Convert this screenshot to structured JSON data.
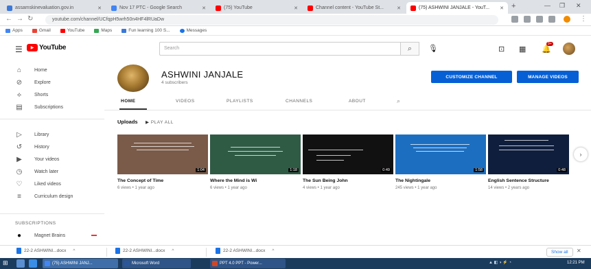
{
  "browser": {
    "tabs": [
      {
        "title": "assamskinevaluation.gov.in",
        "active": false,
        "color": "#3c78d8"
      },
      {
        "title": "Nov 17 PTC - Google Search",
        "active": false,
        "color": "#4285f4"
      },
      {
        "title": "(75) YouTube",
        "active": false,
        "color": "#ff0000"
      },
      {
        "title": "Channel content - YouTube St...",
        "active": false,
        "color": "#ff0000"
      },
      {
        "title": "(75) ASHWINI JANJALE - YouT...",
        "active": true,
        "color": "#ff0000"
      }
    ],
    "new_tab": "+",
    "url": "youtube.com/channel/UCfqpH5wrh50n4HF4lRUaDw",
    "bookmarks": [
      {
        "label": "Apps",
        "color": "#4285f4"
      },
      {
        "label": "Gmail",
        "color": "#ea4335"
      },
      {
        "label": "YouTube",
        "color": "#ff0000"
      },
      {
        "label": "Maps",
        "color": "#34a853"
      },
      {
        "label": "Fun learning 100 S...",
        "color": "#3c78d8"
      },
      {
        "label": "Messages",
        "color": "#1a73e8"
      }
    ]
  },
  "youtube": {
    "logo_text": "YouTube",
    "search_placeholder": "Search",
    "notification_count": "9+",
    "sidebar": {
      "primary": [
        {
          "label": "Home",
          "icon": "⌂"
        },
        {
          "label": "Explore",
          "icon": "⊘"
        },
        {
          "label": "Shorts",
          "icon": "⟡"
        },
        {
          "label": "Subscriptions",
          "icon": "▤"
        }
      ],
      "library": [
        {
          "label": "Library",
          "icon": "▷"
        },
        {
          "label": "History",
          "icon": "↺"
        },
        {
          "label": "Your videos",
          "icon": "▶"
        },
        {
          "label": "Watch later",
          "icon": "◷"
        },
        {
          "label": "Liked videos",
          "icon": "♡"
        },
        {
          "label": "Curriculum design",
          "icon": "≡"
        }
      ],
      "subscriptions_heading": "SUBSCRIPTIONS",
      "subscriptions": [
        {
          "label": "Magnet Brains"
        }
      ]
    },
    "channel": {
      "name": "ASHWINI JANJALE",
      "subscribers": "4 subscribers",
      "customize_button": "CUSTOMIZE CHANNEL",
      "manage_button": "MANAGE VIDEOS",
      "tabs": [
        "HOME",
        "VIDEOS",
        "PLAYLISTS",
        "CHANNELS",
        "ABOUT"
      ],
      "active_tab": "HOME",
      "uploads_label": "Uploads",
      "play_all_label": "PLAY ALL"
    },
    "videos": [
      {
        "title": "The Concept of Time",
        "meta": "6 views • 1 year ago",
        "duration": "1:04",
        "bg": "#7a5a48"
      },
      {
        "title": "Where the Mind is Wi",
        "meta": "6 views • 1 year ago",
        "duration": "1:18",
        "bg": "#2f5b45"
      },
      {
        "title": "The Sun Being John",
        "meta": "4 views • 1 year ago",
        "duration": "0:49",
        "bg": "#111111"
      },
      {
        "title": "The Nightingale",
        "meta": "245 views • 1 year ago",
        "duration": "1:58",
        "bg": "#1c6fc0"
      },
      {
        "title": "English Sentence Structure",
        "meta": "14 views • 2 years ago",
        "duration": "0:48",
        "bg": "#0f1e3d"
      }
    ]
  },
  "downloads": [
    {
      "name": "22-2 ASHWINI...docx"
    },
    {
      "name": "22-2 ASHWINI...docx"
    },
    {
      "name": "22-2 ASHWINI...docx"
    }
  ],
  "downloads_show_all": "Show all",
  "taskbar": {
    "tasks": [
      {
        "label": "(75) ASHWINI JANJ...",
        "color": "#4285f4"
      },
      {
        "label": "Microsoft Word",
        "color": "#2b579a"
      },
      {
        "label": "PPT 4.0 PPT - Power...",
        "color": "#d24726"
      }
    ],
    "clock": "12:21 PM"
  }
}
